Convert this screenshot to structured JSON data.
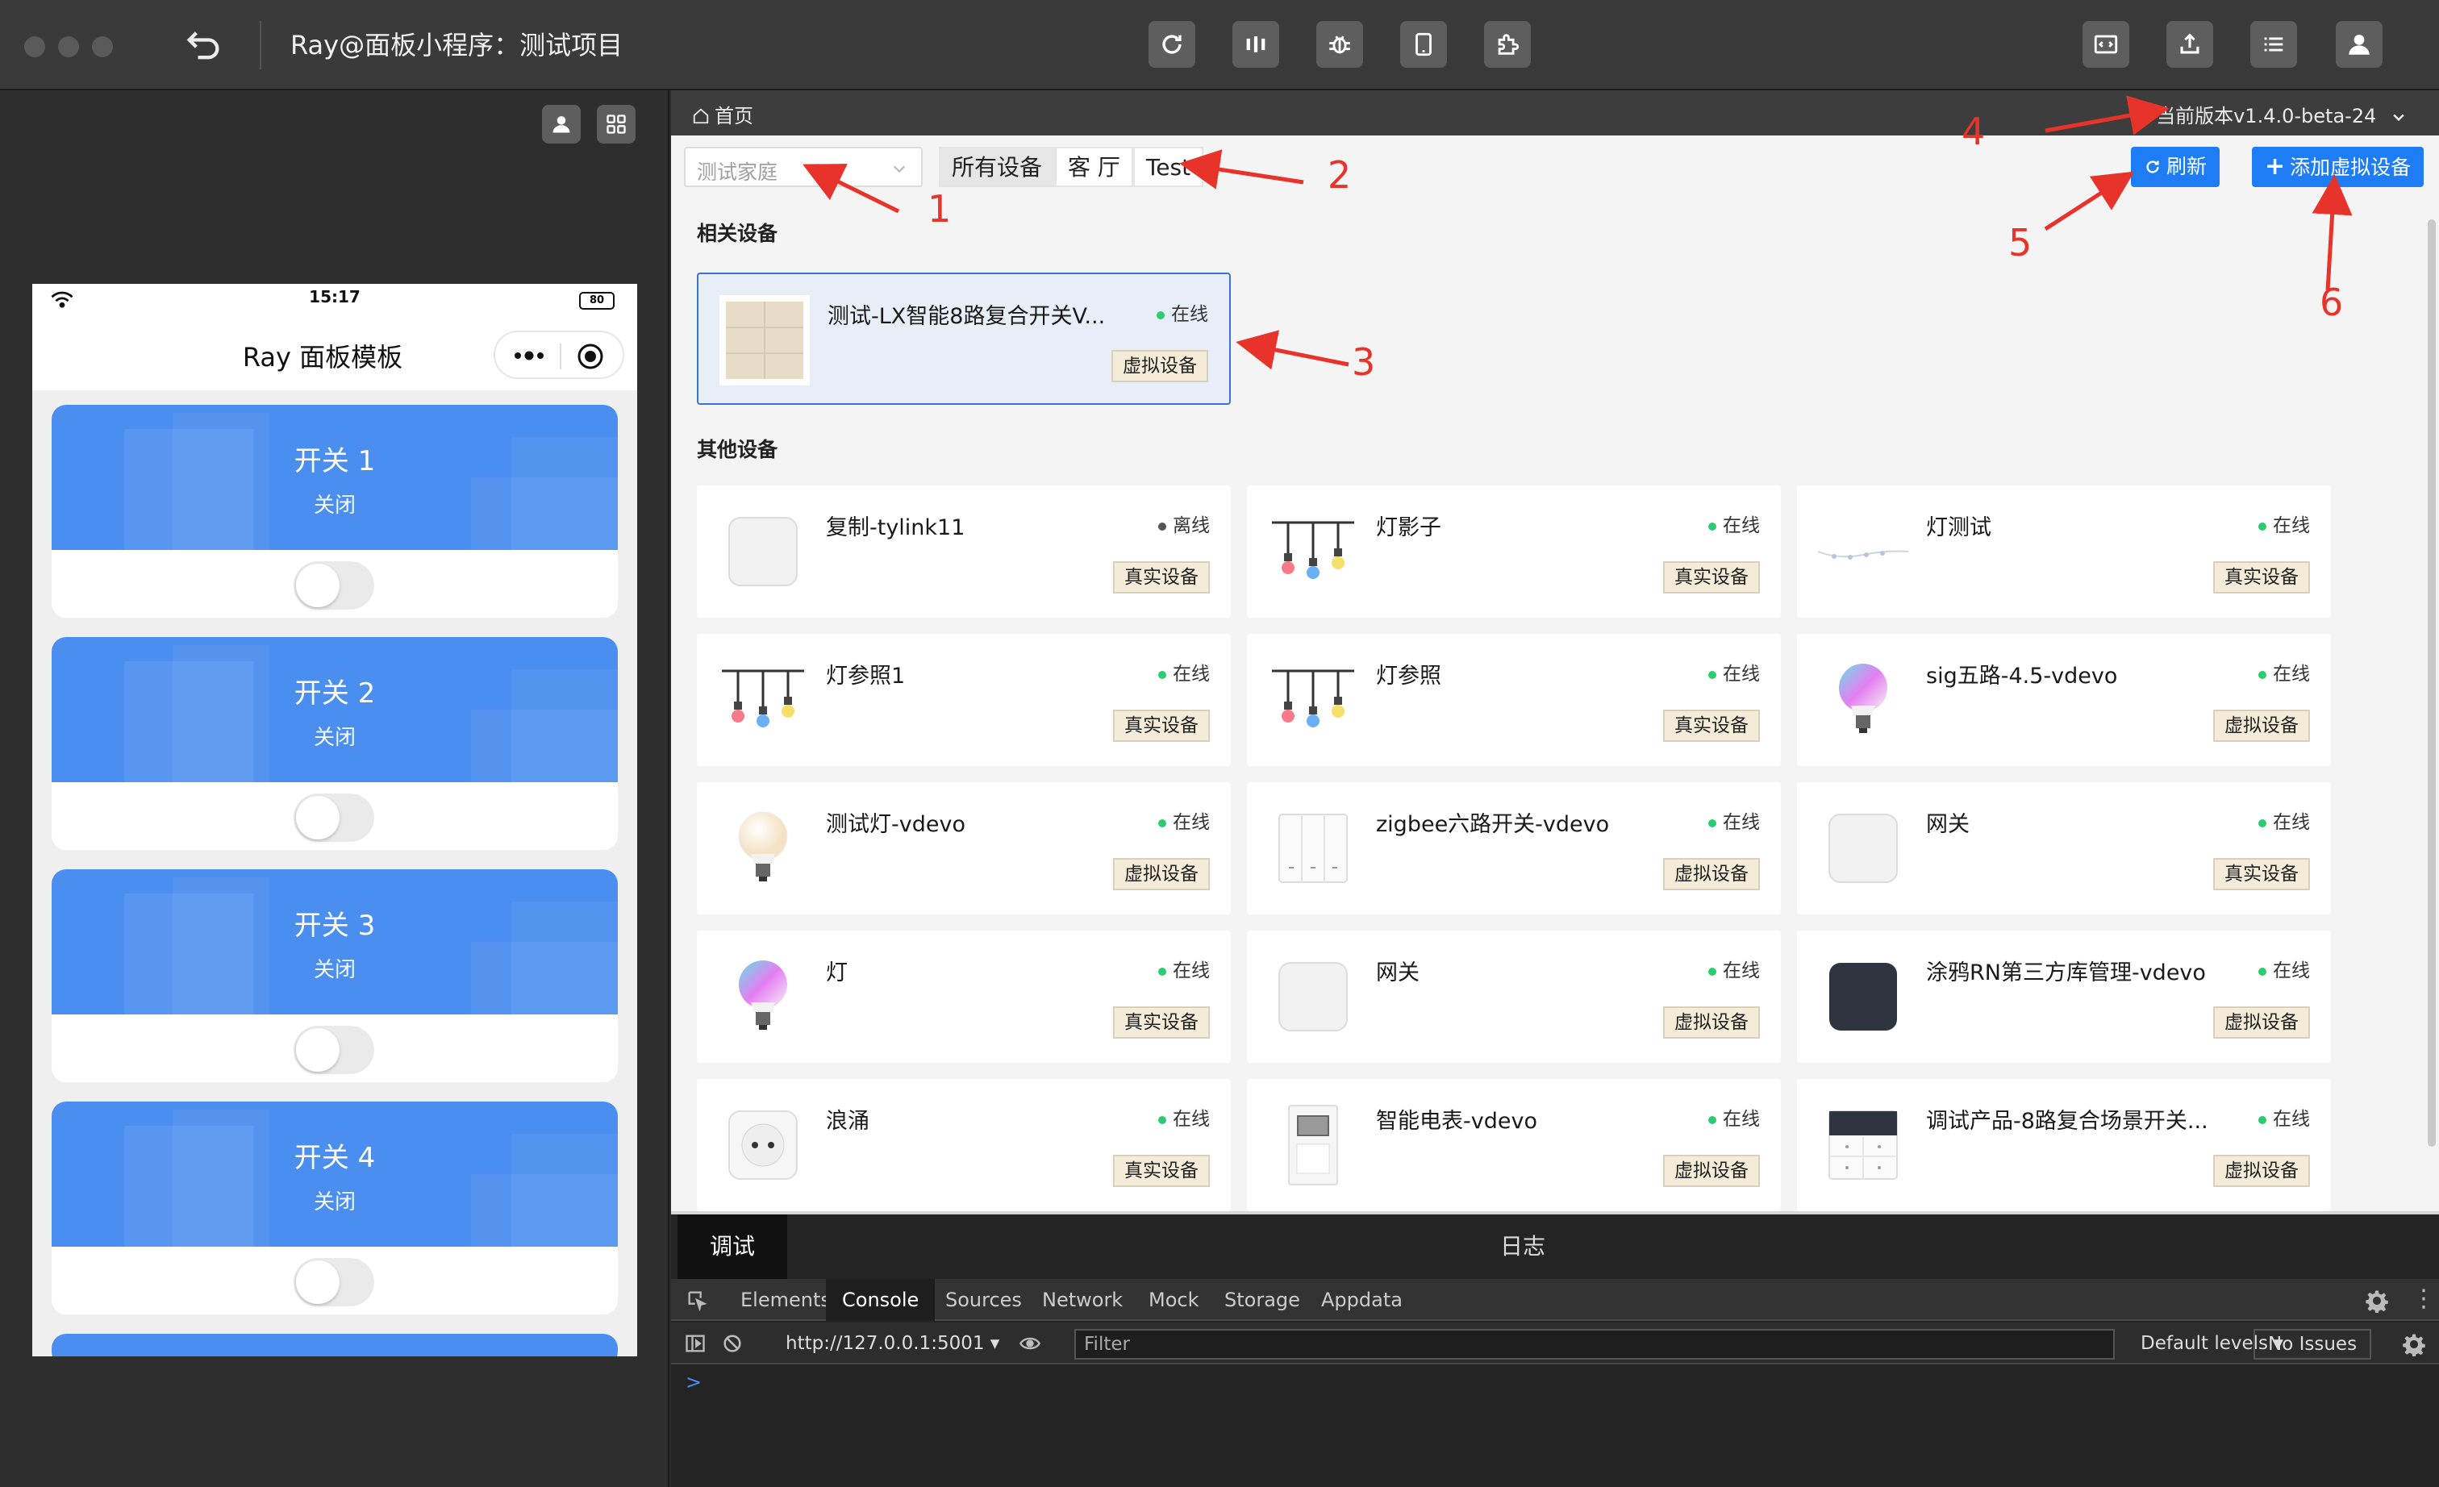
{
  "window": {
    "title": "Ray@面板小程序：测试项目"
  },
  "simulator": {
    "time": "15:17",
    "battery": "80",
    "nav_title": "Ray 面板模板",
    "cards": [
      {
        "title": "开关 1",
        "status": "关闭"
      },
      {
        "title": "开关 2",
        "status": "关闭"
      },
      {
        "title": "开关 3",
        "status": "关闭"
      },
      {
        "title": "开关 4",
        "status": "关闭"
      }
    ]
  },
  "main": {
    "breadcrumb": "首页",
    "version": "当前版本v1.4.0-beta-24",
    "home_select_placeholder": "测试家庭",
    "room_tabs": [
      "所有设备",
      "客 厅",
      "Test"
    ],
    "refresh_label": "刷新",
    "add_virtual_label": "添加虚拟设备",
    "related_title": "相关设备",
    "other_title": "其他设备",
    "related_devices": [
      {
        "name": "测试-LX智能8路复合开关V...",
        "status": "在线",
        "tag": "虚拟设备",
        "icon": "panel-switch-icon"
      }
    ],
    "other_devices": [
      {
        "name": "复制-tylink11",
        "status": "离线",
        "tag": "真实设备",
        "icon": "white-box-icon"
      },
      {
        "name": "灯影子",
        "status": "在线",
        "tag": "真实设备",
        "icon": "string-lights-icon"
      },
      {
        "name": "灯测试",
        "status": "在线",
        "tag": "真实设备",
        "icon": "light-strand-icon"
      },
      {
        "name": "灯参照1",
        "status": "在线",
        "tag": "真实设备",
        "icon": "string-lights-icon"
      },
      {
        "name": "灯参照",
        "status": "在线",
        "tag": "真实设备",
        "icon": "string-lights-icon"
      },
      {
        "name": "sig五路-4.5-vdevo",
        "status": "在线",
        "tag": "虚拟设备",
        "icon": "rgb-bulb-icon"
      },
      {
        "name": "测试灯-vdevo",
        "status": "在线",
        "tag": "虚拟设备",
        "icon": "bulb-icon"
      },
      {
        "name": "zigbee六路开关-vdevo",
        "status": "在线",
        "tag": "虚拟设备",
        "icon": "wall-switch-icon"
      },
      {
        "name": "网关",
        "status": "在线",
        "tag": "真实设备",
        "icon": "white-box-icon"
      },
      {
        "name": "灯",
        "status": "在线",
        "tag": "真实设备",
        "icon": "rgb-bulb-icon"
      },
      {
        "name": "网关",
        "status": "在线",
        "tag": "虚拟设备",
        "icon": "white-box-icon"
      },
      {
        "name": "涂鸦RN第三方库管理-vdevo",
        "status": "在线",
        "tag": "虚拟设备",
        "icon": "dark-panel-icon"
      },
      {
        "name": "浪涌",
        "status": "在线",
        "tag": "真实设备",
        "icon": "socket-icon"
      },
      {
        "name": "智能电表-vdevo",
        "status": "在线",
        "tag": "虚拟设备",
        "icon": "meter-icon"
      },
      {
        "name": "调试产品-8路复合场景开关...",
        "status": "在线",
        "tag": "虚拟设备",
        "icon": "scene-switch-icon"
      }
    ],
    "status_colors": {
      "online": "#2ecc71",
      "offline": "#555555"
    }
  },
  "annotations": [
    "1",
    "2",
    "3",
    "4",
    "5",
    "6"
  ],
  "devtools": {
    "top_tabs": [
      "调试",
      "日志"
    ],
    "panels": [
      "Elements",
      "Console",
      "Sources",
      "Network",
      "Mock",
      "Storage",
      "Appdata"
    ],
    "context": "http://127.0.0.1:5001",
    "filter_placeholder": "Filter",
    "levels": "Default levels",
    "issues": "No Issues",
    "prompt": ">"
  }
}
